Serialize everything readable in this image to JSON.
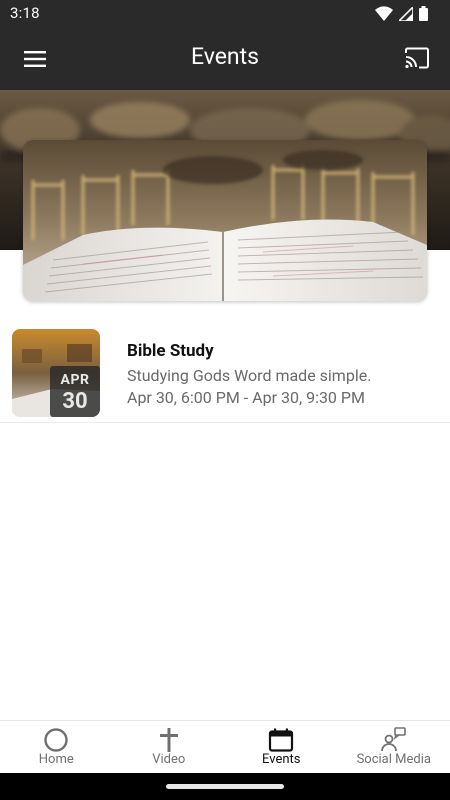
{
  "status_bar": {
    "time": "3:18",
    "icons": [
      "wifi-icon",
      "cellular-signal-icon",
      "battery-icon"
    ]
  },
  "app_bar": {
    "title": "Events",
    "menu_icon": "hamburger-menu-icon",
    "cast_icon": "cast-icon"
  },
  "hero": {
    "image": "open-bible-with-chairs-photo"
  },
  "events": [
    {
      "title": "Bible Study",
      "description": "Studying Gods Word made simple.",
      "time_range": "Apr 30, 6:00 PM - Apr 30, 9:30 PM",
      "date_month": "APR",
      "date_day": "30"
    }
  ],
  "bottom_nav": {
    "items": [
      {
        "label": "Home",
        "icon": "circle-icon",
        "active": false
      },
      {
        "label": "Video",
        "icon": "cross-icon",
        "active": false
      },
      {
        "label": "Events",
        "icon": "calendar-icon",
        "active": true
      },
      {
        "label": "Social Media",
        "icon": "social-person-icon",
        "active": false
      }
    ]
  },
  "colors": {
    "app_bar": "#2a2a2a",
    "active_nav": "#111111",
    "inactive_nav": "#707070"
  }
}
